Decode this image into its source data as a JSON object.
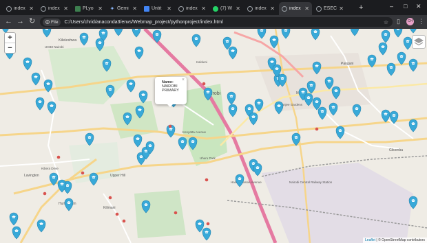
{
  "browser": {
    "tabs": [
      {
        "title": "index",
        "icon": "globe-icon",
        "active": false
      },
      {
        "title": "index",
        "icon": "globe-icon",
        "active": false
      },
      {
        "title": "PLyo",
        "icon": "python-icon",
        "active": false
      },
      {
        "title": "Gemi",
        "icon": "gemini-icon",
        "active": false
      },
      {
        "title": "Untit",
        "icon": "jupyter-icon",
        "active": false
      },
      {
        "title": "index",
        "icon": "globe-icon",
        "active": false
      },
      {
        "title": "(7) W",
        "icon": "whatsapp-icon",
        "active": false
      },
      {
        "title": "index",
        "icon": "globe-icon",
        "active": false
      },
      {
        "title": "index",
        "icon": "globe-icon",
        "active": true
      },
      {
        "title": "ESEC",
        "icon": "globe-icon",
        "active": false
      }
    ],
    "new_tab_label": "+",
    "window": {
      "minimize": "–",
      "maximize": "□",
      "close": "✕"
    },
    "address": {
      "chip_label": "File",
      "url": "C:/Users/chrid/anaconda3/envs/Webmap_project/pythonproject/index.html"
    }
  },
  "map": {
    "zoom_in": "+",
    "zoom_out": "−",
    "popup": {
      "name_label": "Name:",
      "name_value": "NAIROBI PRIMARY",
      "close": "×"
    },
    "attribution": {
      "leaflet": "Leaflet",
      "text": " | © OpenStreetMap contributors"
    },
    "labels": [
      "Nairobi",
      "Kileleshwa",
      "Lavington",
      "Kilimani",
      "Hurlingham",
      "Ngara",
      "Pangani",
      "Nairobi Central Railway Station",
      "Uhuru Park",
      "Kenyatta Avenue",
      "Haile Selassie Avenue",
      "Upper Hill",
      "Kibera Drive",
      "Gikomba",
      "UCB0 Nairobi",
      "Kaloleni",
      "Jeevanjee Gardens"
    ],
    "marker_color": "#38a9d8",
    "marker_count": 88
  }
}
